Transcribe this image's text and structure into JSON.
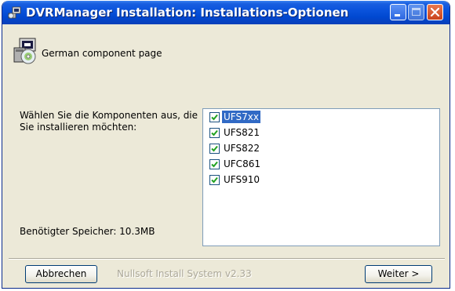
{
  "window": {
    "title": "DVRManager Installation: Installations-Optionen"
  },
  "header": {
    "text": "German component page"
  },
  "components": {
    "description": "Wählen Sie die Komponenten aus, die Sie installieren möchten:",
    "items": [
      {
        "label": "UFS7xx",
        "checked": true,
        "selected": true
      },
      {
        "label": "UFS821",
        "checked": true,
        "selected": false
      },
      {
        "label": "UFS822",
        "checked": true,
        "selected": false
      },
      {
        "label": "UFC861",
        "checked": true,
        "selected": false
      },
      {
        "label": "UFS910",
        "checked": true,
        "selected": false
      }
    ],
    "space_required": "Benötigter Speicher: 10.3MB"
  },
  "footer": {
    "cancel_label": "Abbrechen",
    "branding": "Nullsoft Install System v2.33",
    "next_label": "Weiter >"
  },
  "colors": {
    "titlebar": "#0a53dc",
    "dialog_bg": "#ece9d8",
    "selection": "#316ac5",
    "close_button": "#c9421b"
  },
  "icons": {
    "title": "installer-icon",
    "header": "installer-disc-icon",
    "checkbox_mark": "checkmark-icon"
  }
}
